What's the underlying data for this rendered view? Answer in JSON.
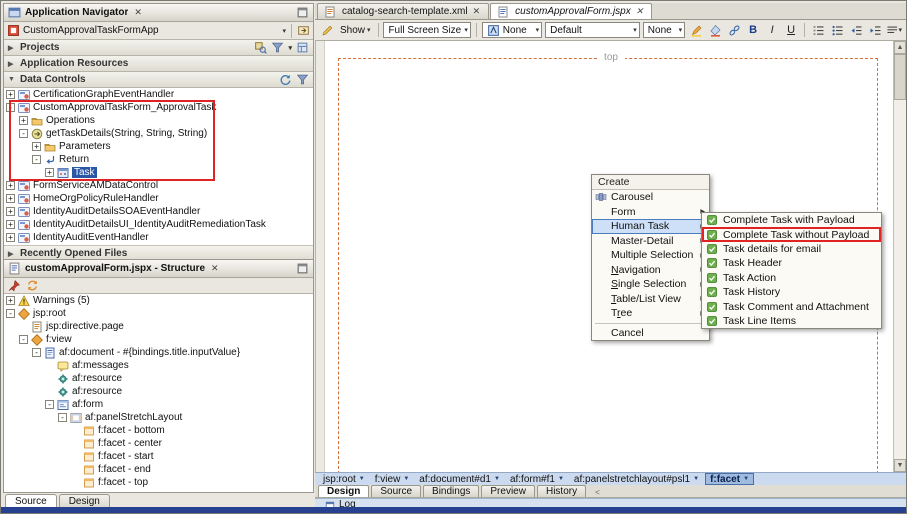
{
  "colors": {
    "selection_blue": "#2a57a5",
    "annotation_red": "#e02424",
    "canvas_dash_orange": "#d2703c",
    "breadcrumb_bar": "#cbdaee"
  },
  "app_navigator": {
    "tab_title": "Application Navigator",
    "workspace_selector": "CustomApprovalTaskFormApp",
    "projects_label": "Projects",
    "app_resources_label": "Application Resources",
    "data_controls_label": "Data Controls",
    "recent_files_label": "Recently Opened Files",
    "tree": [
      {
        "label": "CertificationGraphEventHandler",
        "indent": 0,
        "toggle": "+",
        "icon": "datacontrol"
      },
      {
        "label": "CustomApprovalTaskForm_ApprovalTask",
        "indent": 0,
        "toggle": "-",
        "icon": "datacontrol"
      },
      {
        "label": "Operations",
        "indent": 1,
        "toggle": "+",
        "icon": "folder"
      },
      {
        "label": "getTaskDetails(String, String, String)",
        "indent": 1,
        "toggle": "-",
        "icon": "method"
      },
      {
        "label": "Parameters",
        "indent": 2,
        "toggle": "+",
        "icon": "folder"
      },
      {
        "label": "Return",
        "indent": 2,
        "toggle": "-",
        "icon": "return"
      },
      {
        "label": "Task",
        "indent": 3,
        "toggle": "+",
        "icon": "struct",
        "selected": true
      },
      {
        "label": "FormServiceAMDataControl",
        "indent": 0,
        "toggle": "+",
        "icon": "datacontrol"
      },
      {
        "label": "HomeOrgPolicyRuleHandler",
        "indent": 0,
        "toggle": "+",
        "icon": "datacontrol"
      },
      {
        "label": "IdentityAuditDetailsSOAEventHandler",
        "indent": 0,
        "toggle": "+",
        "icon": "datacontrol"
      },
      {
        "label": "IdentityAuditDetailsUI_IdentityAuditRemediationTask",
        "indent": 0,
        "toggle": "+",
        "icon": "datacontrol"
      },
      {
        "label": "IdentityAuditEventHandler",
        "indent": 0,
        "toggle": "+",
        "icon": "datacontrol"
      }
    ]
  },
  "structure_panel": {
    "tab_title": "customApprovalForm.jspx - Structure",
    "tree": [
      {
        "label": "Warnings (5)",
        "indent": 0,
        "toggle": "+",
        "icon": "warning"
      },
      {
        "label": "jsp:root",
        "indent": 0,
        "toggle": "-",
        "icon": "tagorange"
      },
      {
        "label": "jsp:directive.page",
        "indent": 1,
        "toggle": "",
        "icon": "directive"
      },
      {
        "label": "f:view",
        "indent": 1,
        "toggle": "-",
        "icon": "tagorange"
      },
      {
        "label": "af:document - #{bindings.title.inputValue}",
        "indent": 2,
        "toggle": "-",
        "icon": "document"
      },
      {
        "label": "af:messages",
        "indent": 3,
        "toggle": "",
        "icon": "messages"
      },
      {
        "label": "af:resource",
        "indent": 3,
        "toggle": "",
        "icon": "resource"
      },
      {
        "label": "af:resource",
        "indent": 3,
        "toggle": "",
        "icon": "resource"
      },
      {
        "label": "af:form",
        "indent": 3,
        "toggle": "-",
        "icon": "form"
      },
      {
        "label": "af:panelStretchLayout",
        "indent": 4,
        "toggle": "-",
        "icon": "panel"
      },
      {
        "label": "f:facet - bottom",
        "indent": 5,
        "toggle": "",
        "icon": "facet"
      },
      {
        "label": "f:facet - center",
        "indent": 5,
        "toggle": "",
        "icon": "facet"
      },
      {
        "label": "f:facet - start",
        "indent": 5,
        "toggle": "",
        "icon": "facet"
      },
      {
        "label": "f:facet - end",
        "indent": 5,
        "toggle": "",
        "icon": "facet"
      },
      {
        "label": "f:facet - top",
        "indent": 5,
        "toggle": "",
        "icon": "facet"
      }
    ],
    "bottom_tabs": [
      {
        "label": "Source",
        "active": true
      },
      {
        "label": "Design",
        "active": false
      }
    ]
  },
  "editor": {
    "tabs": [
      {
        "label": "catalog-search-template.xml",
        "active": false,
        "icon": "xmldoc"
      },
      {
        "label": "customApprovalForm.jspx",
        "active": true,
        "icon": "jspxdoc"
      }
    ],
    "toolbar": {
      "show_label": "Show",
      "screen_size": "Full Screen Size",
      "style": "None",
      "font": "Default",
      "font_size": "None",
      "bold": "B",
      "italic": "I",
      "underline": "U"
    },
    "canvas": {
      "facet_label": "top"
    },
    "breadcrumbs": [
      {
        "label": "jsp:root"
      },
      {
        "label": "f:view"
      },
      {
        "label": "af:document#d1"
      },
      {
        "label": "af:form#f1"
      },
      {
        "label": "af:panelstretchlayout#psl1"
      },
      {
        "label": "f:facet",
        "selected": true
      }
    ],
    "bottom_tabs": [
      {
        "label": "Design",
        "active": true
      },
      {
        "label": "Source",
        "active": false
      },
      {
        "label": "Bindings",
        "active": false
      },
      {
        "label": "Preview",
        "active": false
      },
      {
        "label": "History",
        "active": false
      }
    ],
    "tab_scroll_label": "<",
    "log_label": "Log"
  },
  "context_menu": {
    "title": "Create",
    "items": [
      {
        "label": "Carousel",
        "icon": "carousel",
        "submenu": false
      },
      {
        "label": "Form",
        "submenu": true
      },
      {
        "label": "Human Task",
        "submenu": true,
        "highlighted": true
      },
      {
        "label": "Master-Detail",
        "submenu": true
      },
      {
        "label": "Multiple Selection",
        "submenu": true
      },
      {
        "label": "Navigation",
        "submenu": true,
        "mnemonic": 0
      },
      {
        "label": "Single Selection",
        "submenu": true,
        "mnemonic": 0
      },
      {
        "label": "Table/List View",
        "submenu": true,
        "mnemonic": 0
      },
      {
        "label": "Tree",
        "submenu": true,
        "mnemonic": 1
      },
      {
        "label": "Cancel",
        "separated": true
      }
    ]
  },
  "human_task_submenu": {
    "items": [
      {
        "label": "Complete Task with Payload"
      },
      {
        "label": "Complete Task without Payload",
        "boxed": true
      },
      {
        "label": "Task details for email"
      },
      {
        "label": "Task Header"
      },
      {
        "label": "Task Action"
      },
      {
        "label": "Task History"
      },
      {
        "label": "Task Comment and Attachment"
      },
      {
        "label": "Task Line Items"
      }
    ]
  }
}
